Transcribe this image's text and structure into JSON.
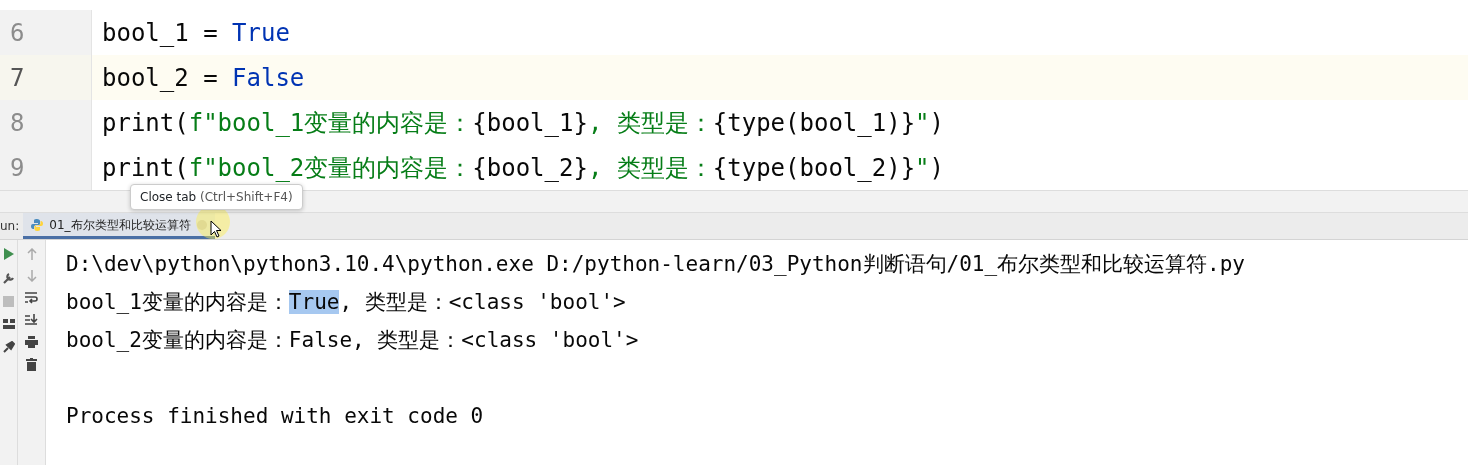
{
  "editor": {
    "lines": [
      {
        "number": "6",
        "current": false,
        "tokens": [
          {
            "kind": "plain",
            "text": "bool_1 = "
          },
          {
            "kind": "keyword",
            "text": "True"
          }
        ]
      },
      {
        "number": "7",
        "current": true,
        "tokens": [
          {
            "kind": "plain",
            "text": "bool_2 = "
          },
          {
            "kind": "keyword",
            "text": "False"
          }
        ]
      },
      {
        "number": "8",
        "current": false,
        "tokens": [
          {
            "kind": "plain",
            "text": "print("
          },
          {
            "kind": "string",
            "text": "f\"bool_1变量的内容是："
          },
          {
            "kind": "plain",
            "text": "{bool_1}"
          },
          {
            "kind": "string",
            "text": ", 类型是："
          },
          {
            "kind": "plain",
            "text": "{type(bool_1)}"
          },
          {
            "kind": "string",
            "text": "\""
          },
          {
            "kind": "plain",
            "text": ")"
          }
        ]
      },
      {
        "number": "9",
        "current": false,
        "tokens": [
          {
            "kind": "plain",
            "text": "print("
          },
          {
            "kind": "string",
            "text": "f\"bool_2变量的内容是："
          },
          {
            "kind": "plain",
            "text": "{bool_2}"
          },
          {
            "kind": "string",
            "text": ", 类型是："
          },
          {
            "kind": "plain",
            "text": "{type(bool_2)}"
          },
          {
            "kind": "string",
            "text": "\""
          },
          {
            "kind": "plain",
            "text": ")"
          }
        ]
      }
    ]
  },
  "tooltip": {
    "label": "Close tab",
    "shortcut": "(Ctrl+Shift+F4)"
  },
  "run_panel": {
    "label": "un:",
    "tabs": [
      {
        "label": "01_布尔类型和比较运算符",
        "selected": true
      }
    ],
    "output": [
      {
        "kind": "text",
        "segments": [
          {
            "text": "D:\\dev\\python\\python3.10.4\\python.exe D:/python-learn/03_Python判断语句/01_布尔类型和比较运算符.py",
            "selected": false
          }
        ]
      },
      {
        "kind": "text",
        "segments": [
          {
            "text": "bool_1变量的内容是：",
            "selected": false
          },
          {
            "text": "True",
            "selected": true
          },
          {
            "text": ", 类型是：<class 'bool'>",
            "selected": false
          }
        ]
      },
      {
        "kind": "text",
        "segments": [
          {
            "text": "bool_2变量的内容是：False, 类型是：<class 'bool'>",
            "selected": false
          }
        ]
      },
      {
        "kind": "blank"
      },
      {
        "kind": "text",
        "segments": [
          {
            "text": "Process finished with exit code 0",
            "selected": false
          }
        ]
      }
    ]
  }
}
